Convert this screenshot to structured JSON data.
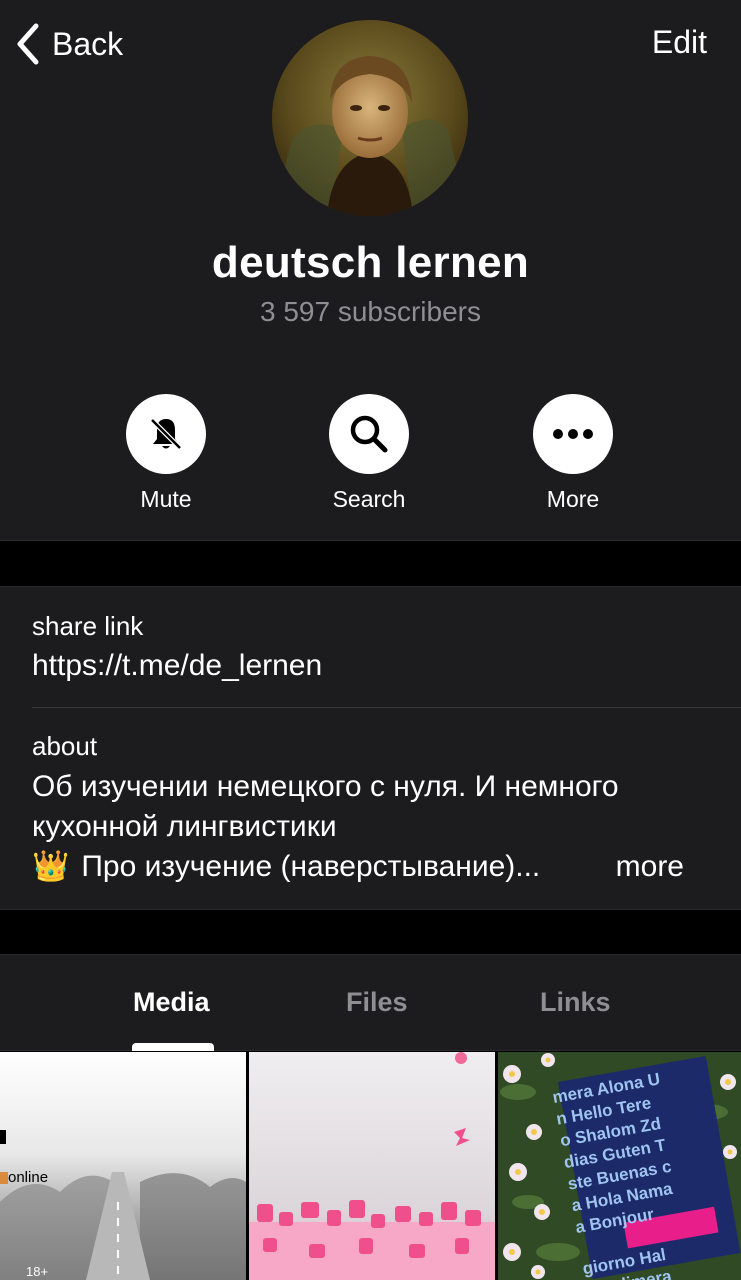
{
  "nav": {
    "back_label": "Back",
    "edit_label": "Edit"
  },
  "channel": {
    "name": "deutsch lernen",
    "subscribers": "3 597 subscribers"
  },
  "actions": [
    {
      "label": "Mute",
      "icon": "bell-slash-icon"
    },
    {
      "label": "Search",
      "icon": "search-icon"
    },
    {
      "label": "More",
      "icon": "ellipsis-icon"
    }
  ],
  "info": {
    "share_label": "share link",
    "share_value": "https://t.me/de_lernen",
    "about_label": "about",
    "about_lines": [
      "Об изучении немецкого с нуля. И немного",
      "кухонной лингвистики",
      "Про изучение (наверстывание)..."
    ],
    "about_emoji": "👑",
    "more_label": "more"
  },
  "tabs": [
    {
      "label": "Media",
      "active": true
    },
    {
      "label": "Files",
      "active": false
    },
    {
      "label": "Links",
      "active": false
    }
  ],
  "media": [
    {
      "caption": "online",
      "badge": "18+"
    },
    {
      "caption": ""
    },
    {
      "caption_lines": [
        "mera Alona U",
        "n Hello Tere",
        "o Shalom Zd",
        "dias Guten T",
        "ste Buenas c",
        "a Hola Nama",
        "a Bonjour",
        "giorno Hal",
        "a Kalimera"
      ]
    }
  ]
}
